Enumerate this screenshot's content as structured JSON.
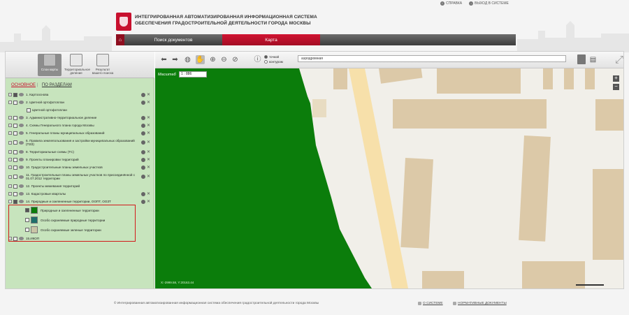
{
  "top_links": {
    "help": "СПРАВКА",
    "logout": "ВЫХОД В СИСТЕМЕ"
  },
  "header": {
    "title_line1": "ИНТЕГРИРОВАННАЯ АВТОМАТИЗИРОВАННАЯ ИНФОРМАЦИОННАЯ СИСТЕМА",
    "title_line2": "ОБЕСПЕЧЕНИЯ ГРАДОСТРОИТЕЛЬНОЙ ДЕЯТЕЛЬНОСТИ ГОРОДА МОСКВЫ"
  },
  "nav": {
    "home_icon": "home-icon",
    "tab_search": "Поиск документов",
    "tab_map": "Карта"
  },
  "left_panel": {
    "buttons": [
      {
        "label": "Слои карты",
        "icon": "layers-icon"
      },
      {
        "label": "Территориальное деление",
        "icon": "map-icon"
      },
      {
        "label": "Результат вашего поиска",
        "icon": "search-results-icon"
      }
    ],
    "tab_main": "ОСНОВНОЕ",
    "tab_sections": "ПО РАЗДЕЛАМ",
    "layers": [
      "1. Картооснова",
      "2. Цветной ортофотоплан",
      "Цветной ортофотоплан",
      "3. Административно-территориальное деление",
      "4. Схемы Генерального плана города Москвы",
      "5. Генеральные планы муниципальных образований",
      "6. Правила землепользования и застройки муниципальных образований (ПЗЗ)",
      "8. Территориальные схемы (ТС)",
      "9. Проекты планировки территорий",
      "10. Градостроительные планы земельных участков",
      "11. Градостроительные планы земельных участков по присоединённой с 01.07.2012 территории",
      "12. Проекты межевания территорий",
      "13. Кадастровые кварталы",
      "14. Природные и озелененные территории, ООПТ, ООЗТ",
      "15.ИКОП"
    ],
    "sublayers": [
      {
        "label": "Природные и озелененные территории",
        "color": "#0b7d0b"
      },
      {
        "label": "Особо охраняемые природные территории",
        "color": "#1f6f6a"
      },
      {
        "label": "Особо охраняемые зеленые территории",
        "color": "#c9c4a6"
      }
    ]
  },
  "toolbar": {
    "radio_points": "точкой",
    "radio_contour": "контуром",
    "search_value": "аэродромная"
  },
  "map": {
    "scale_label": "Масштаб",
    "scale_value": "1 : 886",
    "coords": "X:-2999.58, Y:20163.44",
    "green_color": "#0b7d0b",
    "building_color": "#dcc9a8"
  },
  "footer": {
    "copyright": "© Интегрированная автоматизированная информационная система обеспечения градостроительной деятельности города Москвы",
    "about": "О СИСТЕМЕ",
    "docs": "НОРМАТИВНЫЕ ДОКУМЕНТЫ"
  }
}
